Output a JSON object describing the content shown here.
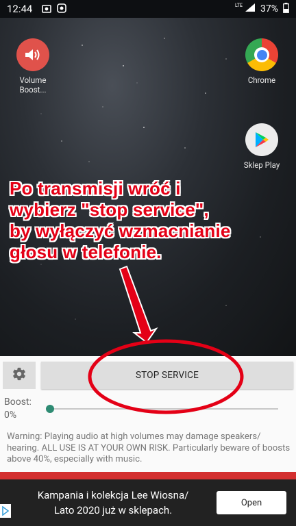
{
  "status_bar": {
    "time": "12:44",
    "network_label": "LTE",
    "battery_percent": "37%"
  },
  "home": {
    "apps": [
      {
        "label": "Volume Boost...",
        "icon": "volume-icon"
      },
      {
        "label": "Chrome",
        "icon": "chrome-icon"
      },
      {
        "label": "Sklep Play",
        "icon": "play-store-icon"
      }
    ]
  },
  "annotation": {
    "lines": [
      "Po transmisji wróć i",
      "wybierz \"stop service\",",
      "by wyłączyć wzmacnianie",
      "głosu w telefonie."
    ],
    "color": "#e40016"
  },
  "controls": {
    "stop_button_label": "STOP SERVICE",
    "boost_label": "Boost:",
    "boost_value": "0%",
    "slider_fraction": 0,
    "warning": "Warning: Playing audio at high volumes may damage speakers/ hearing. ALL USE IS AT YOUR OWN RISK. Particularly beware of boosts above 40%, especially with music."
  },
  "ad": {
    "text_line1": "Kampania i kolekcja Lee Wiosna/",
    "text_line2": "Lato 2020 już w sklepach.",
    "button_label": "Open"
  },
  "colors": {
    "accent": "#2e8b73",
    "ad_bar": "#d32f2f",
    "highlight_circle": "#e40016"
  }
}
